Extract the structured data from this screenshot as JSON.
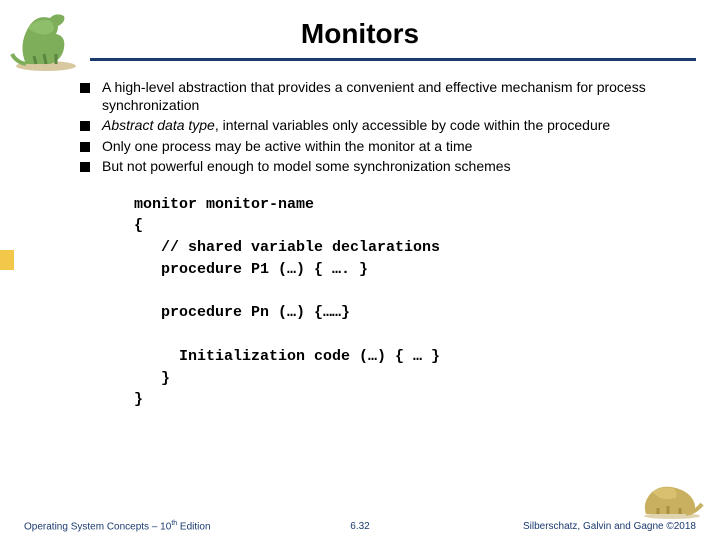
{
  "title": "Monitors",
  "bullets": [
    {
      "text": "A high-level abstraction that provides a convenient and effective mechanism for process synchronization"
    },
    {
      "prefix_italic": "Abstract data type",
      "rest": ", internal variables only accessible by code within the procedure"
    },
    {
      "text": "Only one process may be active within the monitor at a time"
    },
    {
      "text": "But not powerful enough to model some synchronization schemes"
    }
  ],
  "code": "monitor monitor-name\n{\n   // shared variable declarations\n   procedure P1 (…) { …. }\n\n   procedure Pn (…) {……}\n\n     Initialization code (…) { … }\n   }\n}",
  "footer": {
    "left_a": "Operating System Concepts – 10",
    "left_sup": "th",
    "left_b": " Edition",
    "center": "6.32",
    "right": "Silberschatz, Galvin and Gagne ©2018"
  }
}
